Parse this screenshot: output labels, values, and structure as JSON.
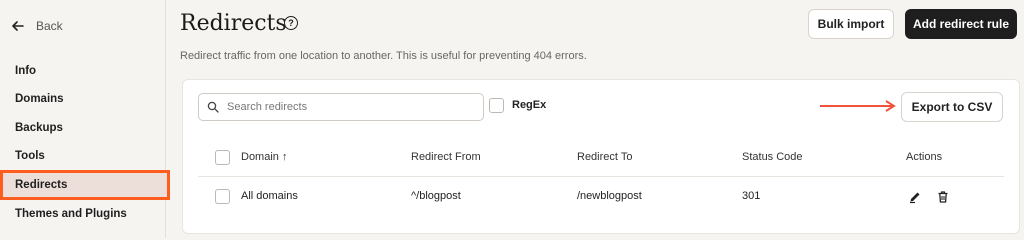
{
  "sidebar": {
    "back_label": "Back",
    "items": [
      {
        "label": "Info"
      },
      {
        "label": "Domains"
      },
      {
        "label": "Backups"
      },
      {
        "label": "Tools"
      },
      {
        "label": "Redirects",
        "active": true
      },
      {
        "label": "Themes and Plugins"
      }
    ]
  },
  "header": {
    "title": "Redirects",
    "help_glyph": "?",
    "subtitle": "Redirect traffic from one location to another. This is useful for preventing 404 errors.",
    "bulk_import_label": "Bulk import",
    "add_rule_label": "Add redirect rule"
  },
  "toolbar": {
    "search_placeholder": "Search redirects",
    "regex_label": "RegEx",
    "export_label": "Export to CSV"
  },
  "table": {
    "headers": [
      "Domain ↑",
      "Redirect From",
      "Redirect To",
      "Status Code",
      "Actions"
    ],
    "rows": [
      {
        "domain": "All domains",
        "from": "^/blogpost",
        "to": "/newblogpost",
        "status": "301"
      }
    ]
  },
  "colors": {
    "accent": "#ff5d1f",
    "primary_button": "#1e1e1e",
    "active_nav_bg": "#ecdfd9",
    "arrow": "#f0533a"
  },
  "icons": {
    "back": "arrow-left-icon",
    "help": "question-circle-icon",
    "search": "search-icon",
    "edit": "pencil-icon",
    "delete": "trash-icon"
  }
}
